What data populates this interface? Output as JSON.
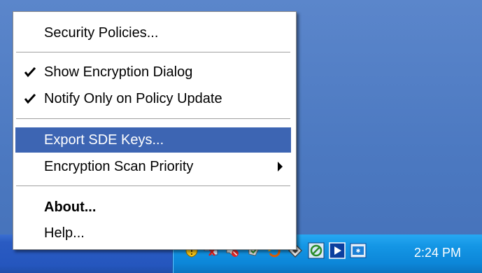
{
  "menu": {
    "items": [
      {
        "label": "Security Policies..."
      },
      {
        "label": "Show Encryption Dialog",
        "checked": true
      },
      {
        "label": "Notify Only on Policy Update",
        "checked": true
      },
      {
        "label": "Export SDE Keys...",
        "highlighted": true
      },
      {
        "label": "Encryption Scan Priority",
        "has_submenu": true
      },
      {
        "label": "About..."
      },
      {
        "label": "Help..."
      }
    ]
  },
  "tray": {
    "clock": "2:24 PM",
    "icons": [
      "shield-warning-icon",
      "network-disconnected-icon",
      "volume-muted-icon",
      "security-check-icon",
      "diamond-app-icon",
      "refresh-app-icon",
      "media-play-icon",
      "encryption-app-icon"
    ]
  },
  "colors": {
    "desktop": "#4c79c1",
    "menu_highlight": "#3d65b3",
    "tray": "#1496e5"
  }
}
